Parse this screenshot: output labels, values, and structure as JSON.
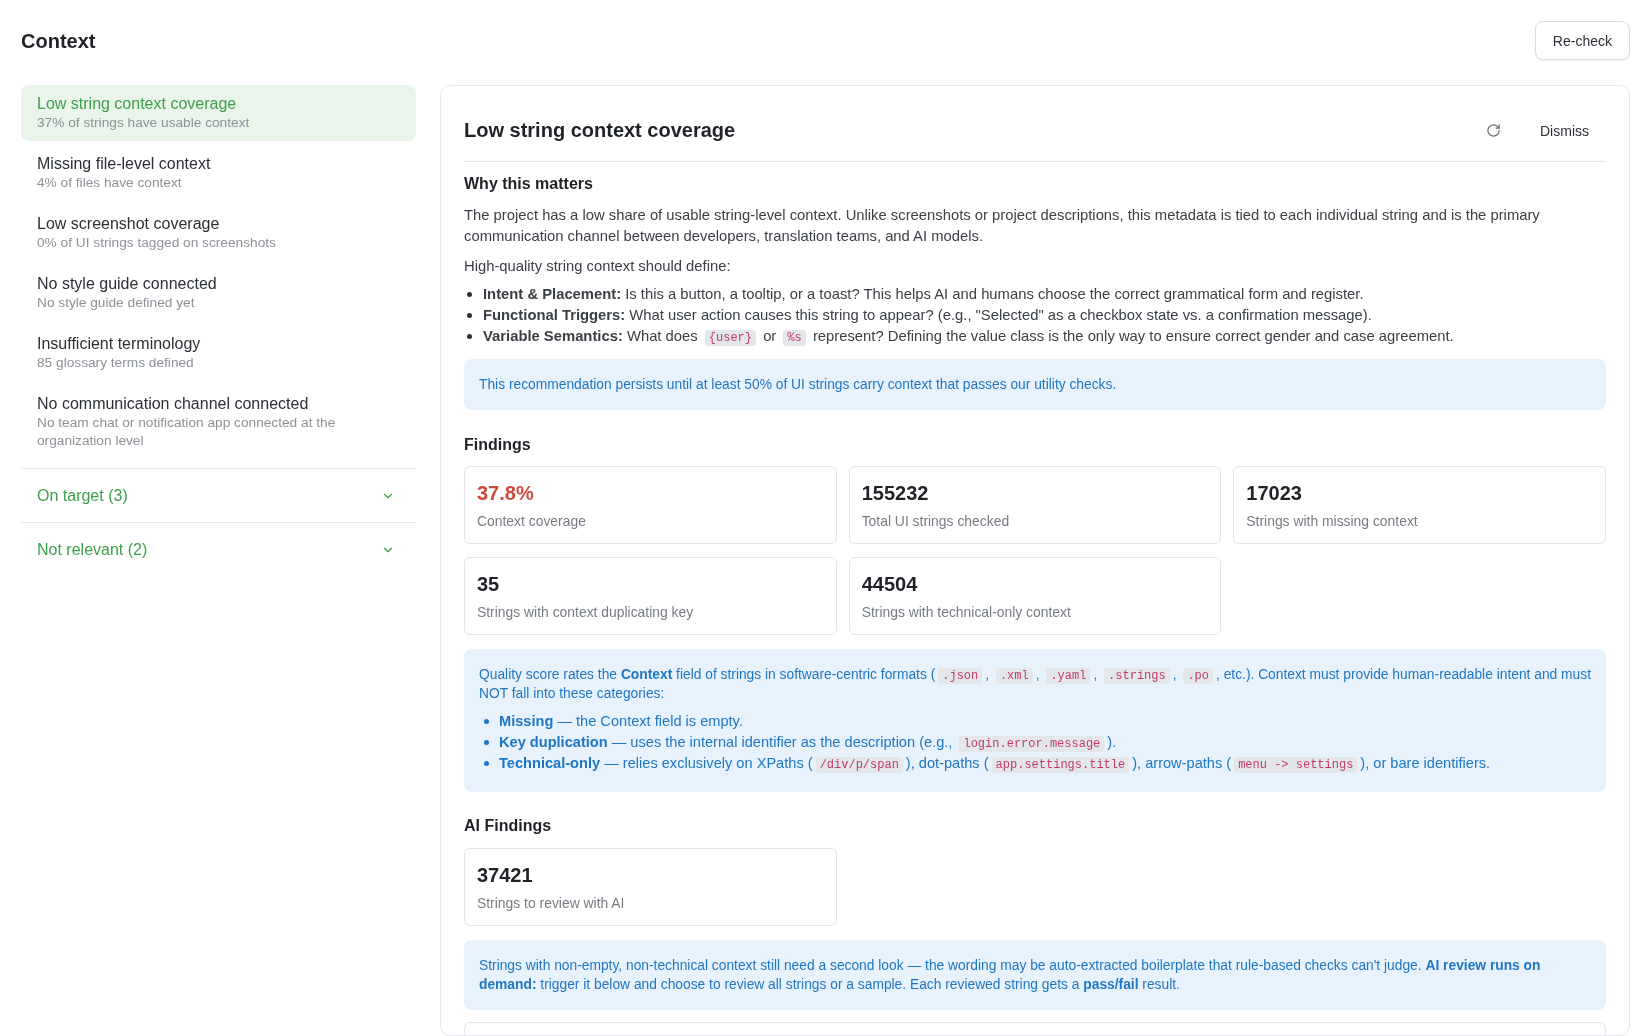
{
  "header": {
    "title": "Context",
    "recheck_button": "Re-check"
  },
  "sidebar": {
    "items": [
      {
        "title": "Low string context coverage",
        "subtitle": "37% of strings have usable context",
        "selected": true
      },
      {
        "title": "Missing file-level context",
        "subtitle": "4% of files have context",
        "selected": false
      },
      {
        "title": "Low screenshot coverage",
        "subtitle": "0% of UI strings tagged on screenshots",
        "selected": false
      },
      {
        "title": "No style guide connected",
        "subtitle": "No style guide defined yet",
        "selected": false
      },
      {
        "title": "Insufficient terminology",
        "subtitle": "85 glossary terms defined",
        "selected": false
      },
      {
        "title": "No communication channel connected",
        "subtitle": "No team chat or notification app connected at the organization level",
        "selected": false
      }
    ],
    "groups": [
      {
        "label": "On target (3)",
        "expanded": false
      },
      {
        "label": "Not relevant (2)",
        "expanded": false
      }
    ]
  },
  "detail": {
    "title": "Low string context coverage",
    "dismiss_button": "Dismiss",
    "why": {
      "heading": "Why this matters",
      "paragraphs": [
        "The project has a low share of usable string-level context. Unlike screenshots or project descriptions, this metadata is tied to each individual string and is the primary communication channel between developers, translation teams, and AI models.",
        "High-quality string context should define:"
      ],
      "bullets": [
        {
          "parts": [
            {
              "kind": "text",
              "text": "**Intent & Placement:** Is this a button, a tooltip, or a toast? This helps AI and humans choose the correct grammatical form and register."
            }
          ]
        },
        {
          "parts": [
            {
              "kind": "text",
              "text": "**Functional Triggers:** What user action causes this string to appear? (e.g., \"Selected\" as a checkbox state vs. a confirmation message)."
            }
          ]
        },
        {
          "parts": [
            {
              "kind": "text",
              "text": "**Variable Semantics:** What does "
            },
            {
              "kind": "code",
              "text": "{user}"
            },
            {
              "kind": "text",
              "text": " or "
            },
            {
              "kind": "code",
              "text": "%s"
            },
            {
              "kind": "text",
              "text": " represent? Defining the value class is the only way to ensure correct gender and case agreement."
            }
          ]
        }
      ],
      "note": "This recommendation persists until at least 50% of UI strings carry context that passes our utility checks."
    },
    "findings": {
      "heading": "Findings",
      "cards": [
        {
          "value": "37.8%",
          "label": "Context coverage",
          "color": "#cf4a3b"
        },
        {
          "value": "155232",
          "label": "Total UI strings checked",
          "color": "#1f2328"
        },
        {
          "value": "17023",
          "label": "Strings with missing context",
          "color": "#1f2328"
        },
        {
          "value": "35",
          "label": "Strings with context duplicating key",
          "color": "#1f2328"
        },
        {
          "value": "44504",
          "label": "Strings with technical-only context",
          "color": "#1f2328"
        }
      ],
      "note": {
        "intro": [
          {
            "kind": "text",
            "text": "Quality score rates the **Context** field of strings in software-centric formats ("
          },
          {
            "kind": "code",
            "text": ".json"
          },
          {
            "kind": "text",
            "text": ", "
          },
          {
            "kind": "code",
            "text": ".xml"
          },
          {
            "kind": "text",
            "text": ", "
          },
          {
            "kind": "code",
            "text": ".yaml"
          },
          {
            "kind": "text",
            "text": ", "
          },
          {
            "kind": "code",
            "text": ".strings"
          },
          {
            "kind": "text",
            "text": ", "
          },
          {
            "kind": "code",
            "text": ".po"
          },
          {
            "kind": "text",
            "text": ", etc.). Context must provide human-readable intent and must NOT fall into these categories:"
          }
        ],
        "bullets": [
          {
            "parts": [
              {
                "kind": "text",
                "text": "**Missing** — the Context field is empty."
              }
            ]
          },
          {
            "parts": [
              {
                "kind": "text",
                "text": "**Key duplication** — uses the internal identifier as the description (e.g., "
              },
              {
                "kind": "code",
                "text": "login.error.message"
              },
              {
                "kind": "text",
                "text": ")."
              }
            ]
          },
          {
            "parts": [
              {
                "kind": "text",
                "text": "**Technical-only** — relies exclusively on XPaths ("
              },
              {
                "kind": "code",
                "text": "/div/p/span"
              },
              {
                "kind": "text",
                "text": "), dot-paths ("
              },
              {
                "kind": "code",
                "text": "app.settings.title"
              },
              {
                "kind": "text",
                "text": "), arrow-paths ("
              },
              {
                "kind": "code",
                "text": "menu -> settings"
              },
              {
                "kind": "text",
                "text": "), or bare identifiers."
              }
            ]
          }
        ]
      }
    },
    "ai_findings": {
      "heading": "AI Findings",
      "cards": [
        {
          "value": "37421",
          "label": "Strings to review with AI",
          "color": "#1f2328"
        }
      ],
      "note": "Strings with non-empty, non-technical context still need a second look — the wording may be auto-extracted boilerplate that rule-based checks can't judge. **AI review runs on demand:** trigger it below and choose to review all strings or a sample. Each reviewed string gets a **pass/fail** result."
    }
  }
}
